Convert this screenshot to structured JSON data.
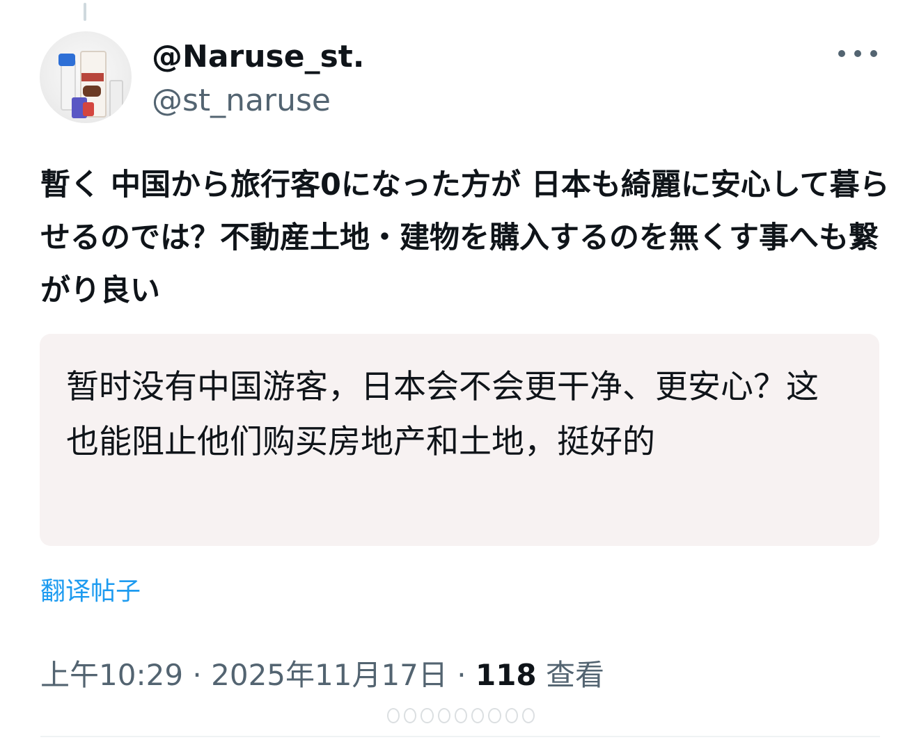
{
  "author": {
    "display_name": "@Naruse_st.",
    "handle": "@st_naruse",
    "avatar_icon": "avatar-image"
  },
  "more_icon": "more-horizontal-icon",
  "tweet": {
    "text": "暫く 中国から旅行客0になった方が  日本も綺麗に安心して暮らせるのでは？不動産土地・建物を購入するのを無くす事へも繋がり良い"
  },
  "translation": {
    "text": "暂时没有中国游客，日本会不会更干净、更安心？这也能阻止他们购买房地产和土地，挺好的",
    "link_label": "翻译帖子"
  },
  "meta": {
    "time": "上午10:29",
    "separator": "·",
    "date": "2025年11月17日",
    "views_count": "118",
    "views_label": "查看"
  },
  "colors": {
    "text": "#0f1419",
    "secondary": "#536471",
    "link": "#1d9bf0",
    "translation_bg": "#f7f2f2"
  }
}
